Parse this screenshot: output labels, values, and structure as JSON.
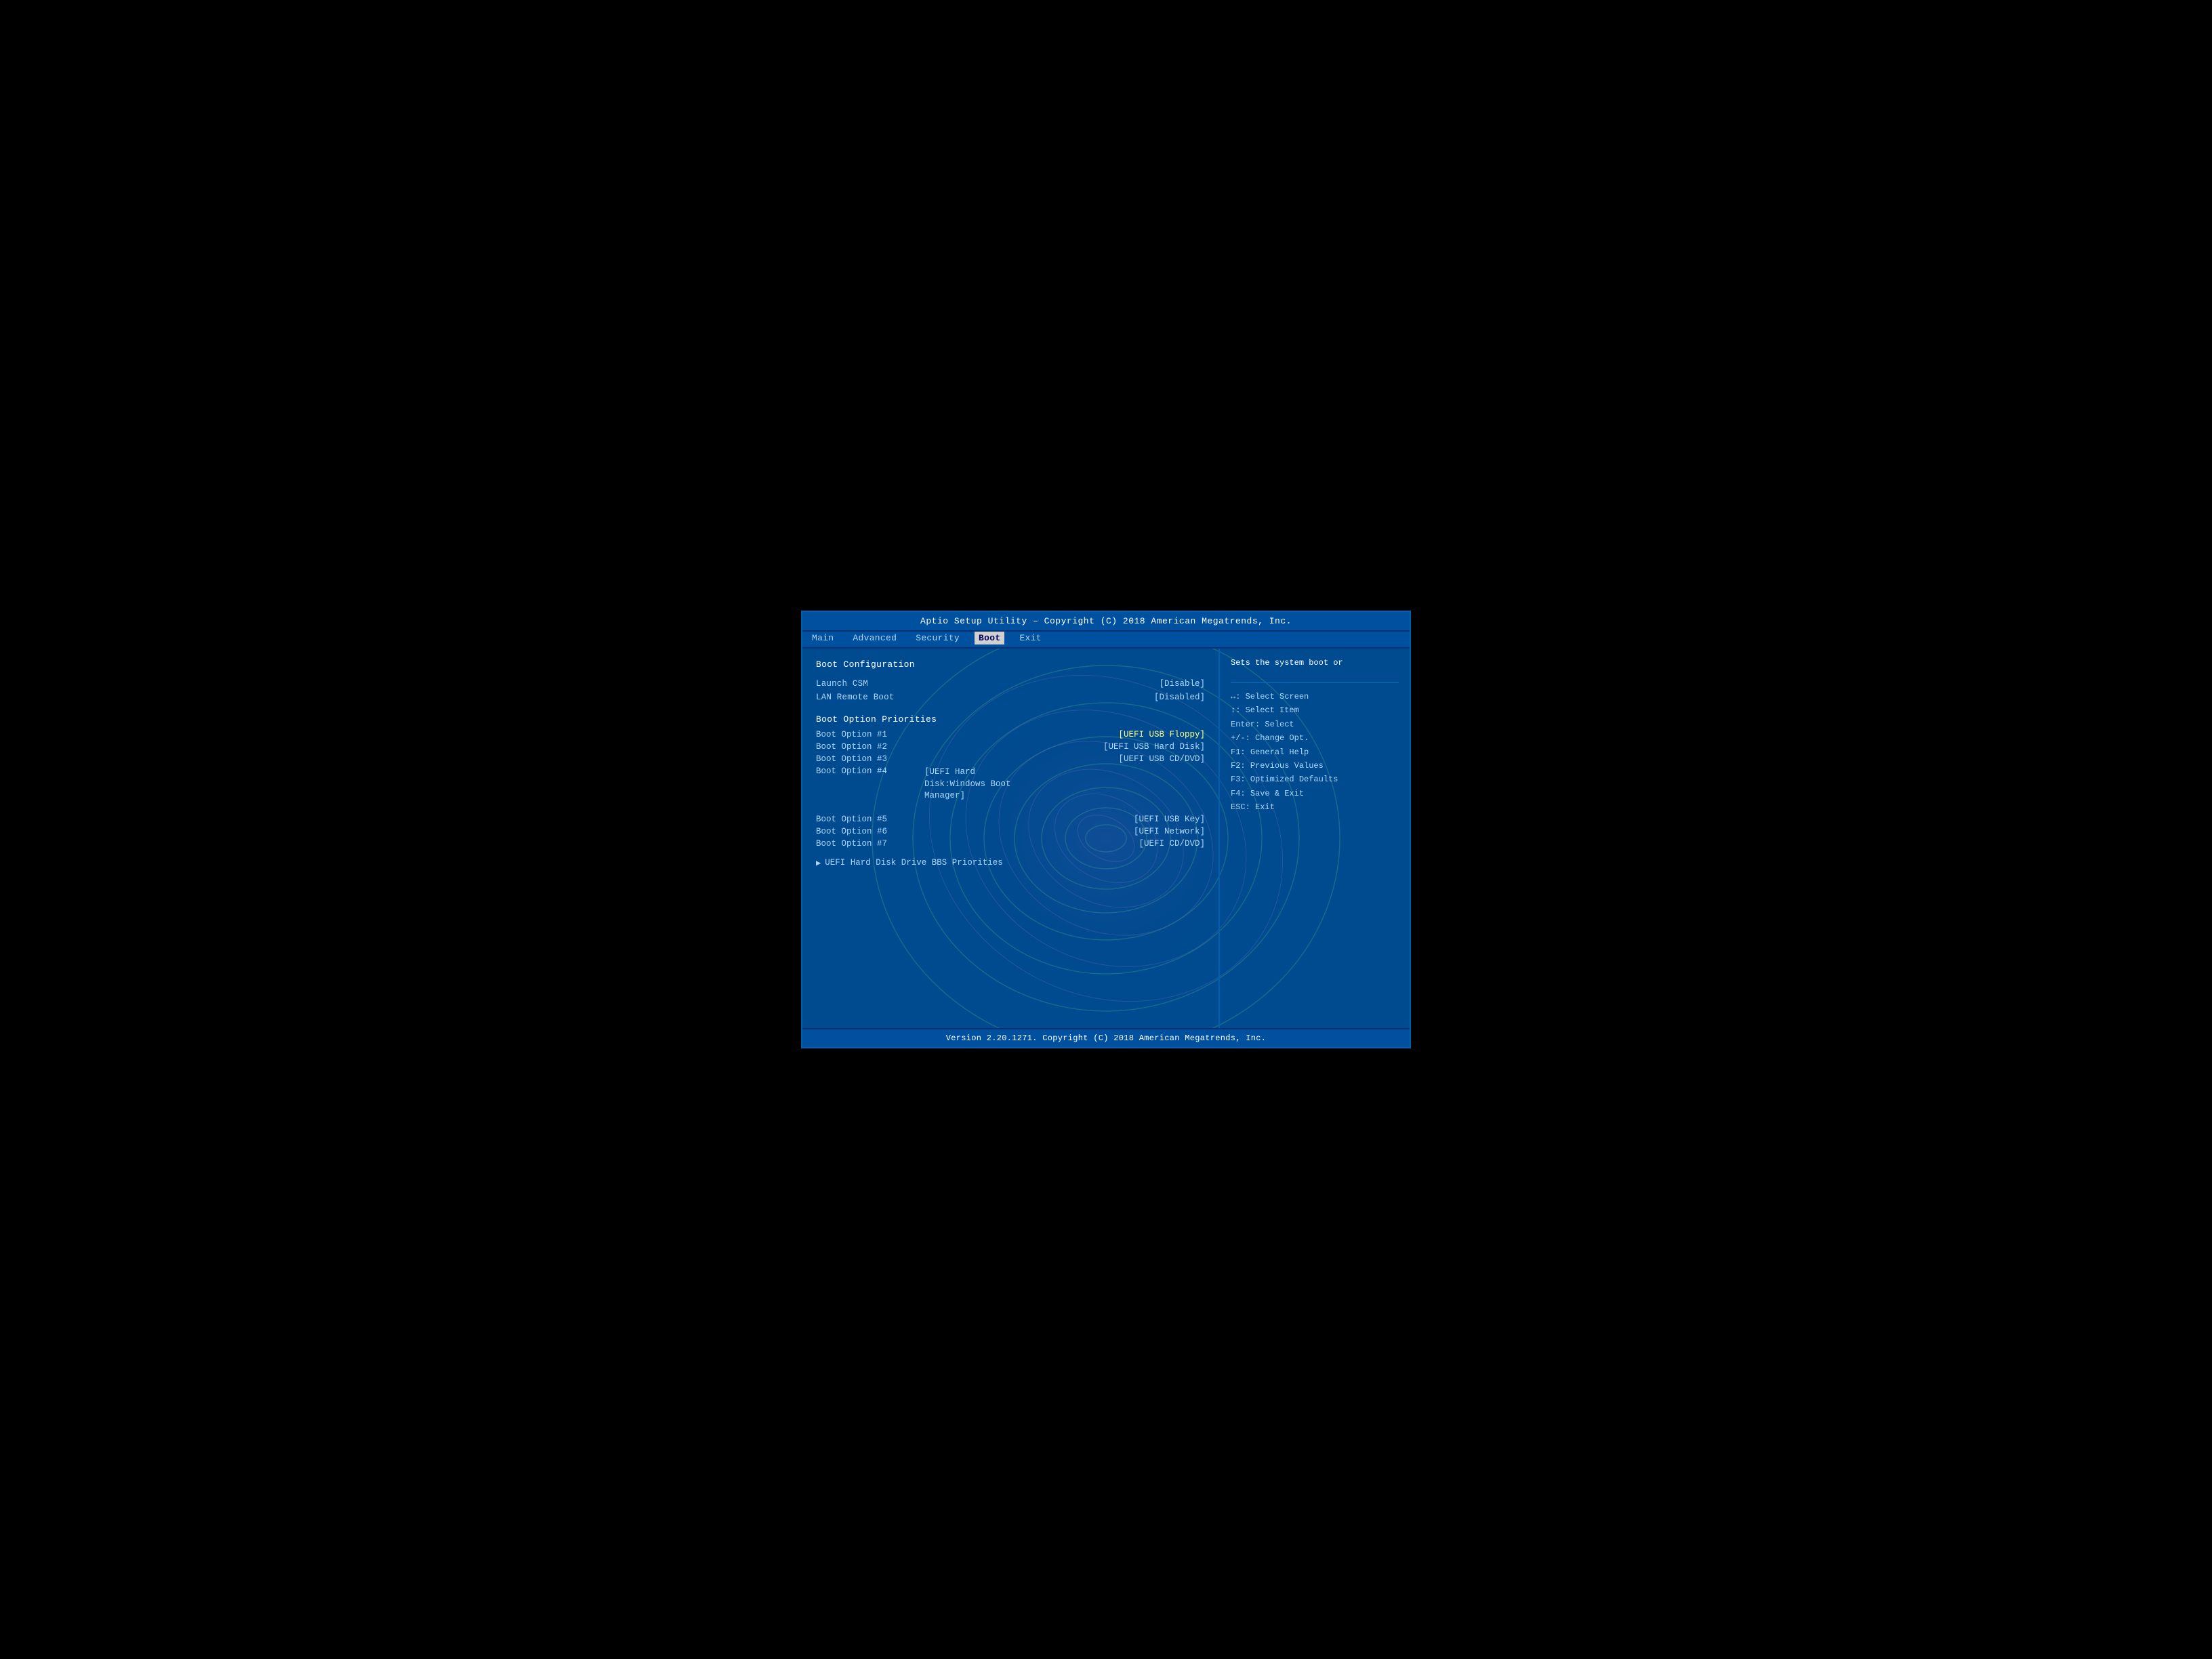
{
  "header": {
    "title": "Aptio Setup Utility – Copyright (C) 2018 American Megatrends, Inc."
  },
  "nav": {
    "items": [
      {
        "id": "main",
        "label": "Main"
      },
      {
        "id": "advanced",
        "label": "Advanced"
      },
      {
        "id": "security",
        "label": "Security"
      },
      {
        "id": "boot",
        "label": "Boot",
        "active": true
      },
      {
        "id": "exit",
        "label": "Exit"
      }
    ]
  },
  "left": {
    "section_title": "Boot Configuration",
    "config_rows": [
      {
        "label": "Launch CSM",
        "value": "[Disable]"
      },
      {
        "label": "LAN Remote Boot",
        "value": "[Disabled]"
      }
    ],
    "priorities_title": "Boot Option Priorities",
    "boot_options": [
      {
        "label": "Boot Option #1",
        "value": "[UEFI USB Floppy]",
        "highlighted": true
      },
      {
        "label": "Boot Option #2",
        "value": "[UEFI USB Hard Disk]"
      },
      {
        "label": "Boot Option #3",
        "value": "[UEFI USB CD/DVD]"
      },
      {
        "label": "Boot Option #4",
        "value": "[UEFI Hard Disk:Windows Boot Manager]",
        "multiline": true
      }
    ],
    "boot_options_lower": [
      {
        "label": "Boot Option #5",
        "value": "[UEFI USB Key]"
      },
      {
        "label": "Boot Option #6",
        "value": "[UEFI Network]"
      },
      {
        "label": "Boot Option #7",
        "value": "[UEFI CD/DVD]"
      }
    ],
    "bbs_label": "UEFI Hard Disk Drive BBS Priorities"
  },
  "right": {
    "help_text": "Sets the system boot or",
    "keys": [
      {
        "key": "↔:",
        "desc": "Select Screen"
      },
      {
        "key": "↕:",
        "desc": "Select Item"
      },
      {
        "key": "Enter:",
        "desc": "Select"
      },
      {
        "key": "+/-:",
        "desc": "Change Opt."
      },
      {
        "key": "F1:",
        "desc": "General Help"
      },
      {
        "key": "F2:",
        "desc": "Previous Values"
      },
      {
        "key": "F3:",
        "desc": "Optimized Defaults"
      },
      {
        "key": "F4:",
        "desc": "Save & Exit"
      },
      {
        "key": "ESC:",
        "desc": "Exit"
      }
    ]
  },
  "footer": {
    "text": "Version 2.20.1271. Copyright (C) 2018 American Megatrends, Inc."
  }
}
